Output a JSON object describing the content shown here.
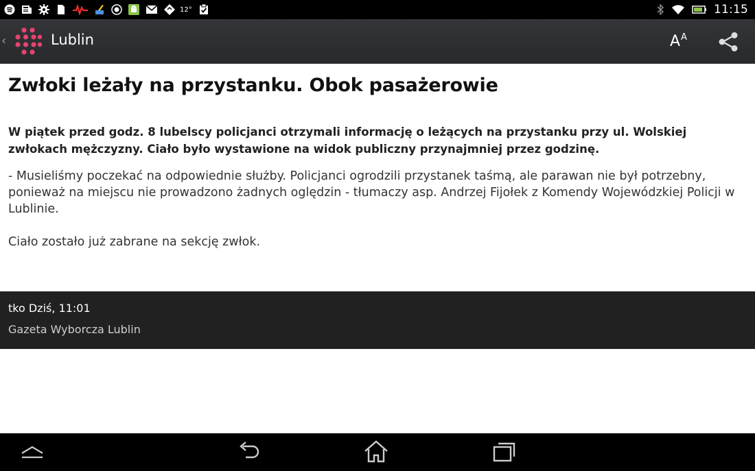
{
  "status_bar": {
    "temperature": "12°",
    "time": "11:15",
    "icons_left": [
      "spotify-icon",
      "news-icon",
      "settings-icon",
      "document-icon",
      "pulse-icon",
      "paint-icon",
      "record-icon",
      "android-icon",
      "gmail-icon",
      "app-icon",
      "clipboard-check-icon"
    ],
    "icons_right": [
      "bluetooth-icon",
      "wifi-icon",
      "battery-icon"
    ]
  },
  "action_bar": {
    "title": "Lublin",
    "font_size_label_big": "A",
    "font_size_label_small": "A",
    "logo_color": "#e8436f"
  },
  "article": {
    "headline": "Zwłoki leżały na przystanku. Obok pasażerowie",
    "lead": "W piątek przed godz. 8 lubelscy policjanci otrzymali informację o leżących na przystanku przy ul. Wolskiej zwłokach mężczyzny. Ciało było wystawione na widok publiczny przynajmniej przez godzinę.",
    "paragraphs": [
      "- Musieliśmy poczekać na odpowiednie służby. Policjanci ogrodzili przystanek taśmą, ale parawan nie był potrzebny, ponieważ na miejscu nie prowadzono żadnych oględzin - tłumaczy asp. Andrzej Fijołek z Komendy Wojewódzkiej Policji w Lublinie.",
      "Ciało zostało już zabrane na sekcję zwłok."
    ]
  },
  "info": {
    "date": "tko Dziś, 11:01",
    "source": "Gazeta Wyborcza Lublin"
  },
  "nav_bar": {
    "buttons": [
      "menu-up-icon",
      "back-icon",
      "home-icon",
      "recent-apps-icon"
    ]
  }
}
